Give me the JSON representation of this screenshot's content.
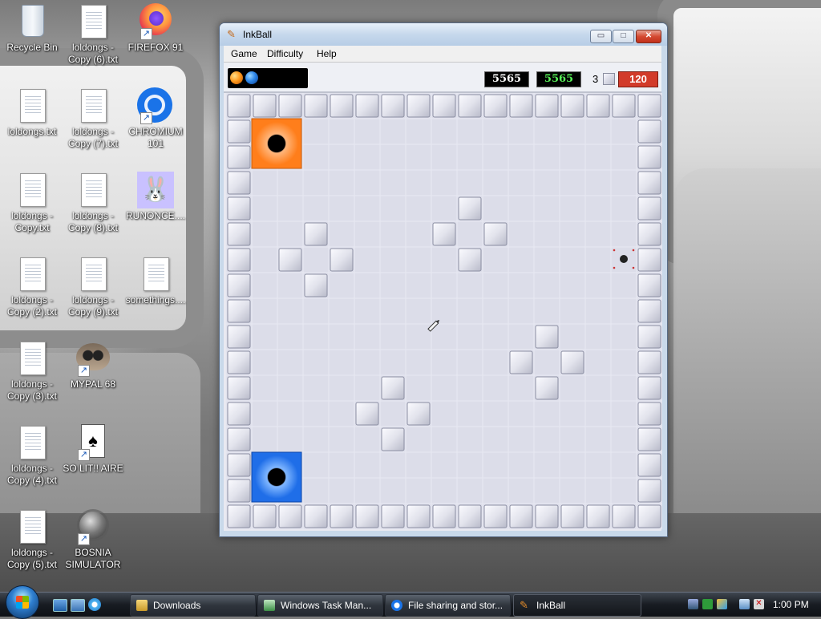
{
  "desktop": {
    "icons": [
      {
        "label": "Recycle Bin"
      },
      {
        "label": "loldongs - Copy (6).txt"
      },
      {
        "label": "FIREFOX 91"
      },
      {
        "label": "loldongs.txt"
      },
      {
        "label": "loldongs - Copy (7).txt"
      },
      {
        "label": "CHROMIUM 101"
      },
      {
        "label": "loldongs - Copy.txt"
      },
      {
        "label": "loldongs - Copy (8).txt"
      },
      {
        "label": "RUNONCE...."
      },
      {
        "label": "loldongs - Copy (2).txt"
      },
      {
        "label": "loldongs - Copy (9).txt"
      },
      {
        "label": "somethings...."
      },
      {
        "label": "loldongs - Copy (3).txt"
      },
      {
        "label": "MYPAL 68"
      },
      {
        "label": "loldongs - Copy (4).txt"
      },
      {
        "label": "SO LIT!! AIRE"
      },
      {
        "label": "loldongs - Copy (5).txt"
      },
      {
        "label": "BOSNIA SIMULATOR"
      }
    ]
  },
  "window": {
    "title": "InkBall",
    "minimize_glyph": "▭",
    "maximize_glyph": "□",
    "close_glyph": "✕"
  },
  "menu": [
    "Game",
    "Difficulty",
    "Help"
  ],
  "game": {
    "score_white": "5565",
    "score_green": "5565",
    "missed_count": "3",
    "timer": "120",
    "colors": {
      "orange_hole": "#ff7e1b",
      "blue_hole": "#1f6ee8",
      "timer_bg": "#d23b2a",
      "green_score": "#57f057"
    }
  },
  "taskbar": {
    "buttons": [
      "Downloads",
      "Windows Task Man...",
      "File sharing and stor...",
      "InkBall"
    ],
    "clock": "1:00 PM"
  }
}
